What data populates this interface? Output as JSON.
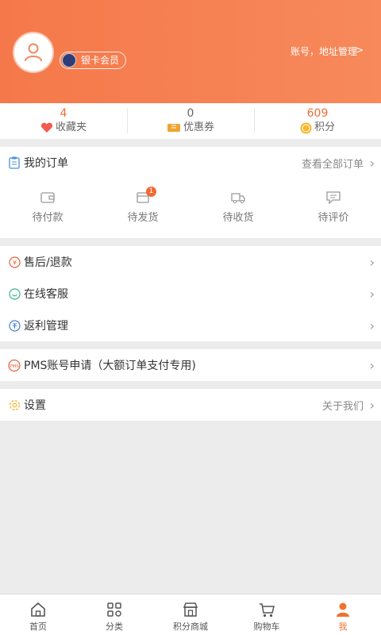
{
  "header": {
    "member_label": "银卡会员",
    "account_link": "账号，地址管理",
    "account_arrow": ">"
  },
  "stats": [
    {
      "value": "4",
      "label": "收藏夹",
      "icon": "heart-icon",
      "color": "#f06a35"
    },
    {
      "value": "0",
      "label": "优惠券",
      "icon": "coupon-icon",
      "color": "#666666"
    },
    {
      "value": "609",
      "label": "积分",
      "icon": "points-coin-icon",
      "color": "#f06a35"
    }
  ],
  "orders": {
    "title": "我的订单",
    "view_all": "查看全部订单",
    "items": [
      {
        "label": "待付款",
        "icon": "wallet-icon"
      },
      {
        "label": "待发货",
        "icon": "box-icon",
        "badge": "1"
      },
      {
        "label": "待收货",
        "icon": "truck-icon"
      },
      {
        "label": "待评价",
        "icon": "comment-icon"
      }
    ]
  },
  "menu": {
    "after_sale": "售后/退款",
    "service": "在线客服",
    "rebate": "返利管理",
    "pms": "PMS账号申请（大额订单支付专用)",
    "settings": "设置",
    "about": "关于我们"
  },
  "tabbar": [
    {
      "label": "首页",
      "icon": "home-icon"
    },
    {
      "label": "分类",
      "icon": "category-icon"
    },
    {
      "label": "积分商城",
      "icon": "store-icon"
    },
    {
      "label": "购物车",
      "icon": "cart-icon"
    },
    {
      "label": "我",
      "icon": "person-icon",
      "active": true
    }
  ],
  "colors": {
    "accent": "#f5784a",
    "badge": "#f06a35"
  }
}
